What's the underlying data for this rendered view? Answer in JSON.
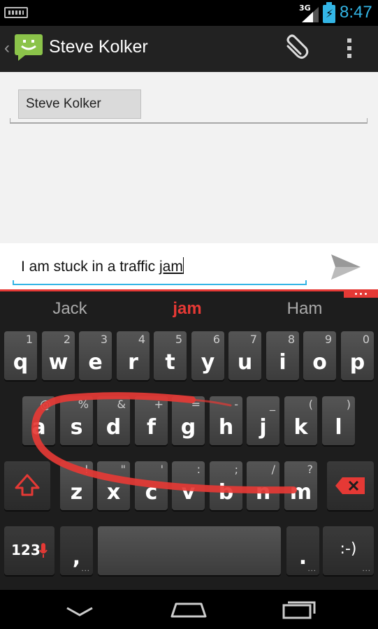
{
  "status": {
    "network": "3G",
    "time": "8:47",
    "accent": "#33b5e5"
  },
  "actionbar": {
    "title": "Steve Kolker",
    "icons": [
      "back-chevron-icon",
      "messaging-app-icon",
      "paperclip-icon",
      "overflow-menu-icon"
    ]
  },
  "recipients": {
    "chip": "Steve Kolker"
  },
  "compose": {
    "text_prefix": "I am stuck in a traffic ",
    "text_composing": "jam",
    "send_icon": "send-icon"
  },
  "keyboard": {
    "accent": "#e53935",
    "suggestions": [
      "Jack",
      "jam",
      "Ham"
    ],
    "row1": [
      {
        "main": "q",
        "alt": "1"
      },
      {
        "main": "w",
        "alt": "2"
      },
      {
        "main": "e",
        "alt": "3"
      },
      {
        "main": "r",
        "alt": "4"
      },
      {
        "main": "t",
        "alt": "5"
      },
      {
        "main": "y",
        "alt": "6"
      },
      {
        "main": "u",
        "alt": "7"
      },
      {
        "main": "i",
        "alt": "8"
      },
      {
        "main": "o",
        "alt": "9"
      },
      {
        "main": "p",
        "alt": "0"
      }
    ],
    "row2": [
      {
        "main": "a",
        "alt": "@"
      },
      {
        "main": "s",
        "alt": "%"
      },
      {
        "main": "d",
        "alt": "&"
      },
      {
        "main": "f",
        "alt": "+"
      },
      {
        "main": "g",
        "alt": "="
      },
      {
        "main": "h",
        "alt": "-"
      },
      {
        "main": "j",
        "alt": "_"
      },
      {
        "main": "k",
        "alt": "("
      },
      {
        "main": "l",
        "alt": ")"
      }
    ],
    "row3": [
      {
        "main": "z",
        "alt": "!"
      },
      {
        "main": "x",
        "alt": "\""
      },
      {
        "main": "c",
        "alt": "'"
      },
      {
        "main": "v",
        "alt": ":"
      },
      {
        "main": "b",
        "alt": ";"
      },
      {
        "main": "n",
        "alt": "/"
      },
      {
        "main": "m",
        "alt": "?"
      }
    ],
    "row4": {
      "symbols": "123",
      "comma": ",",
      "period": ".",
      "emoticon": ":-)",
      "more": "..."
    }
  },
  "navbar": {
    "icons": [
      "back-icon",
      "home-icon",
      "recent-apps-icon"
    ]
  }
}
